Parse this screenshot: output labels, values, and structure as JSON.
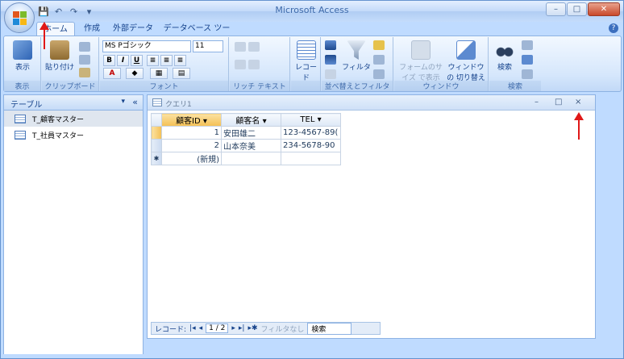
{
  "app": {
    "title": "Microsoft Access"
  },
  "qat": {
    "save": "💾",
    "undo": "↶",
    "redo": "↷",
    "more": "▾"
  },
  "window_controls": {
    "minimize": "–",
    "maximize": "□",
    "close": "✕"
  },
  "tabs": [
    {
      "label": "ホーム"
    },
    {
      "label": "作成"
    },
    {
      "label": "外部データ"
    },
    {
      "label": "データベース ツール"
    }
  ],
  "help": "?",
  "ribbon": {
    "view": {
      "label": "表示",
      "group": "表示"
    },
    "clipboard": {
      "paste": "貼り付け",
      "group": "クリップボード"
    },
    "font": {
      "name": "MS Pゴシック",
      "size": "11",
      "bold": "B",
      "italic": "I",
      "underline": "U",
      "color": "A",
      "group": "フォント"
    },
    "richtext": {
      "group": "リッチ テキスト"
    },
    "records": {
      "label": "レコード",
      "group": ""
    },
    "sort": {
      "filter": "フィルタ",
      "group": "並べ替えとフィルタ"
    },
    "window": {
      "fit": "フォームのサイズ で表示",
      "switch": "ウィンドウの 切り替え",
      "group": "ウィンドウ"
    },
    "find": {
      "label": "検索",
      "group": "検索"
    }
  },
  "nav": {
    "title": "テーブル",
    "dropdown": "▾",
    "collapse": "«",
    "items": [
      {
        "label": "T_顧客マスター",
        "selected": true
      },
      {
        "label": "T_社員マスター",
        "selected": false
      }
    ]
  },
  "query": {
    "title": "クエリ1",
    "columns": [
      "顧客ID",
      "顧客名",
      "TEL"
    ],
    "rows": [
      {
        "id": "1",
        "name": "安田雄二",
        "tel": "123-4567-89("
      },
      {
        "id": "2",
        "name": "山本奈美",
        "tel": "234-5678-90"
      }
    ],
    "new_row": "(新規)",
    "new_marker": "✱",
    "record_nav": {
      "label": "レコード:",
      "position": "1 / 2",
      "filter": "フィルタなし",
      "search": "検索"
    }
  },
  "colors": {
    "arrow": "#e01818",
    "ribbon_bg": "#bfdbff"
  }
}
